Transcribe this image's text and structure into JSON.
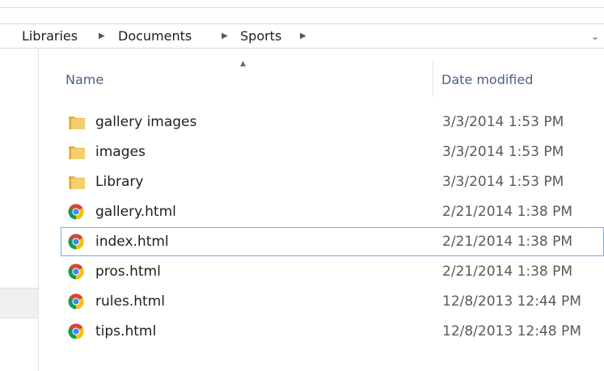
{
  "breadcrumb": {
    "items": [
      "Libraries",
      "Documents",
      "Sports"
    ],
    "separator_icon": "chevron-right-icon",
    "dropdown_icon": "chevron-down-icon"
  },
  "columns": {
    "name": "Name",
    "date_modified": "Date modified",
    "sort_icon": "sort-ascending-icon"
  },
  "files": [
    {
      "name": "gallery images",
      "date": "3/3/2014 1:53 PM",
      "type": "folder",
      "icon": "folder-icon"
    },
    {
      "name": "images",
      "date": "3/3/2014 1:53 PM",
      "type": "folder",
      "icon": "folder-icon"
    },
    {
      "name": "Library",
      "date": "3/3/2014 1:53 PM",
      "type": "folder",
      "icon": "folder-icon"
    },
    {
      "name": "gallery.html",
      "date": "2/21/2014 1:38 PM",
      "type": "html",
      "icon": "chrome-icon"
    },
    {
      "name": "index.html",
      "date": "2/21/2014 1:38 PM",
      "type": "html",
      "icon": "chrome-icon",
      "focused": true
    },
    {
      "name": "pros.html",
      "date": "2/21/2014 1:38 PM",
      "type": "html",
      "icon": "chrome-icon"
    },
    {
      "name": "rules.html",
      "date": "12/8/2013 12:44 PM",
      "type": "html",
      "icon": "chrome-icon"
    },
    {
      "name": "tips.html",
      "date": "12/8/2013 12:48 PM",
      "type": "html",
      "icon": "chrome-icon"
    }
  ],
  "colors": {
    "header_text": "#4d6082",
    "focus_border": "#7aaedc",
    "folder": "#e8b94e",
    "chrome_red": "#db4437",
    "chrome_yellow": "#f4c20d",
    "chrome_green": "#0f9d58",
    "chrome_blue": "#4285f4"
  }
}
